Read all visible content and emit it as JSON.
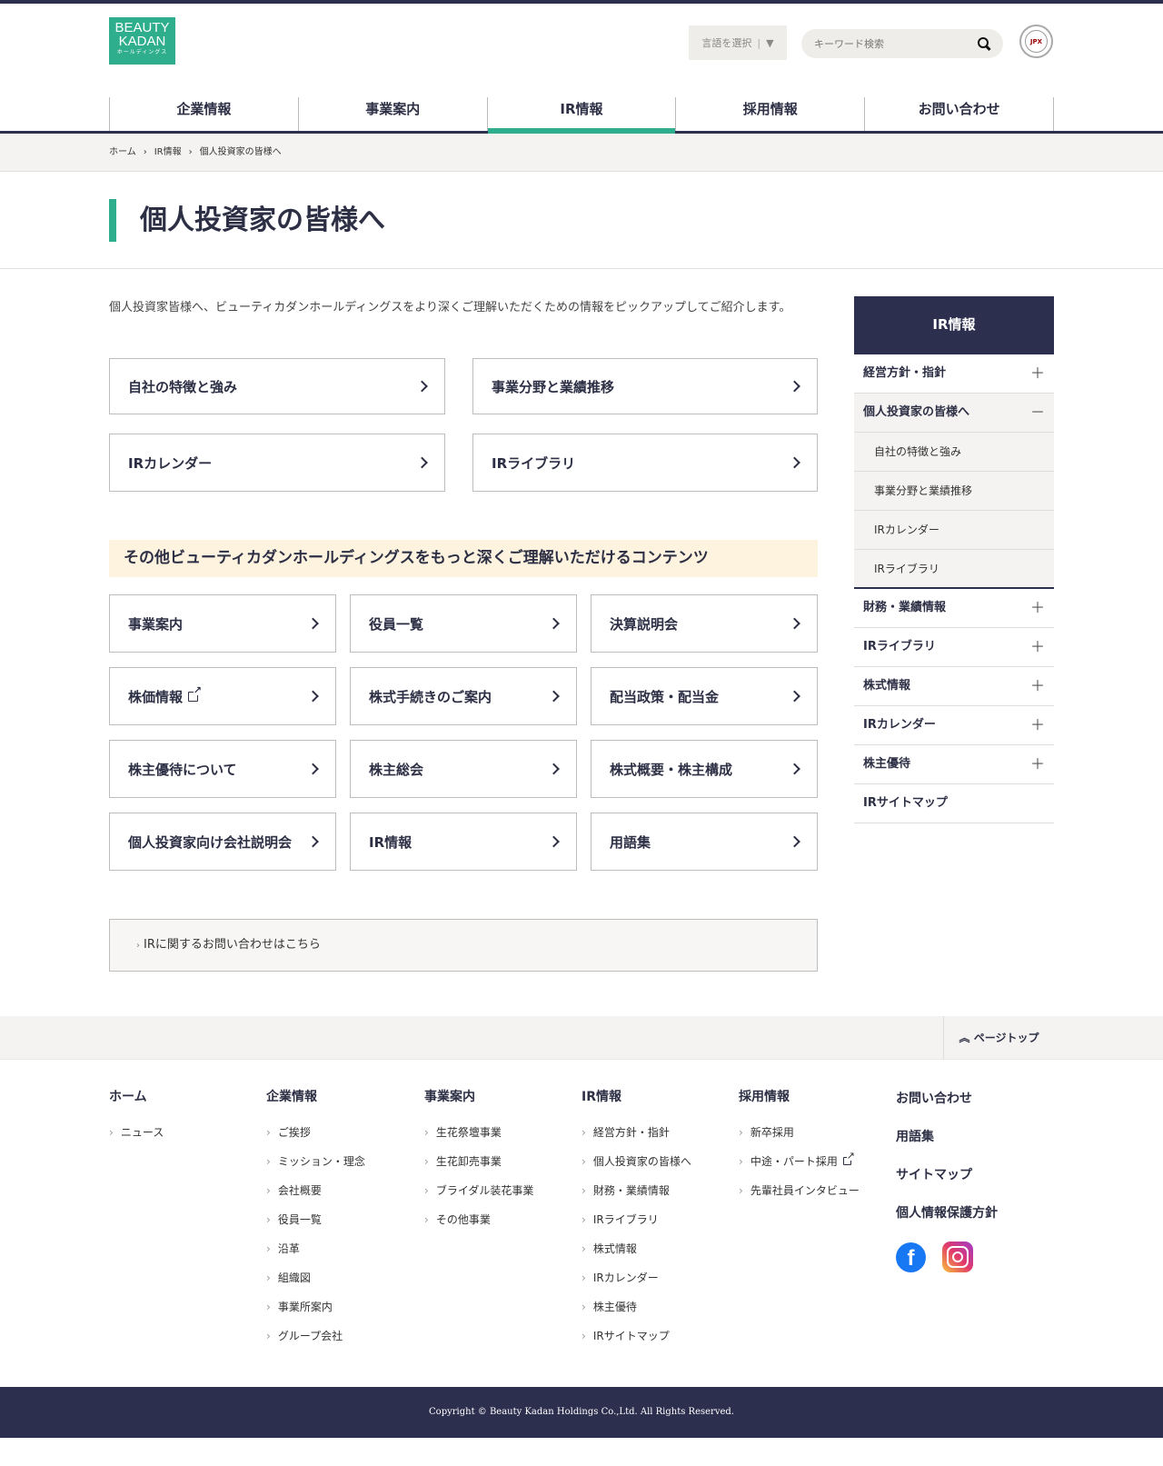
{
  "logo": {
    "line1": "BEAUTY",
    "line2": "KADAN",
    "line3": "ホールディングス"
  },
  "header": {
    "lang_label": "言語を選択",
    "lang_arrow": "▼",
    "search_placeholder": "キーワード検索",
    "seal_text": "JPX"
  },
  "gnav": [
    {
      "label": "企業情報"
    },
    {
      "label": "事業案内"
    },
    {
      "label": "IR情報"
    },
    {
      "label": "採用情報"
    },
    {
      "label": "お問い合わせ"
    }
  ],
  "breadcrumb": [
    "ホーム",
    "IR情報",
    "個人投資家の皆様へ"
  ],
  "page_title": "個人投資家の皆様へ",
  "lead": "個人投資家皆様へ、ビューティカダンホールディングスをより深くご理解いただくための情報をピックアップしてご紹介します。",
  "cards_top": [
    "自社の特徴と強み",
    "事業分野と業績推移",
    "IRカレンダー",
    "IRライブラリ"
  ],
  "band": "その他ビューティカダンホールディングスをもっと深くご理解いただけるコンテンツ",
  "cards_grid": [
    "事業案内",
    "役員一覧",
    "決算説明会",
    "株価情報",
    "株式手続きのご案内",
    "配当政策・配当金",
    "株主優待について",
    "株主総会",
    "株式概要・株主構成",
    "個人投資家向け会社説明会",
    "IR情報",
    "用語集"
  ],
  "contact": "IRに関するお問い合わせはこちら",
  "sidebar": {
    "head": "IR情報",
    "items": [
      {
        "label": "経営方針・指針",
        "sign": "＋"
      },
      {
        "label": "個人投資家の皆様へ",
        "sign": "－"
      },
      {
        "label": "財務・業績情報",
        "sign": "＋"
      },
      {
        "label": "IRライブラリ",
        "sign": "＋"
      },
      {
        "label": "株式情報",
        "sign": "＋"
      },
      {
        "label": "IRカレンダー",
        "sign": "＋"
      },
      {
        "label": "株主優待",
        "sign": "＋"
      },
      {
        "label": "IRサイトマップ",
        "sign": ""
      }
    ],
    "subs": [
      "自社の特徴と強み",
      "事業分野と業績推移",
      "IRカレンダー",
      "IRライブラリ"
    ]
  },
  "pagetop": "ページトップ",
  "footer": {
    "cols": [
      {
        "head": "ホーム",
        "items": [
          "ニュース"
        ]
      },
      {
        "head": "企業情報",
        "items": [
          "ご挨拶",
          "ミッション・理念",
          "会社概要",
          "役員一覧",
          "沿革",
          "組織図",
          "事業所案内",
          "グループ会社"
        ]
      },
      {
        "head": "事業案内",
        "items": [
          "生花祭壇事業",
          "生花卸売事業",
          "ブライダル装花事業",
          "その他事業"
        ]
      },
      {
        "head": "IR情報",
        "items": [
          "経営方針・指針",
          "個人投資家の皆様へ",
          "財務・業績情報",
          "IRライブラリ",
          "株式情報",
          "IRカレンダー",
          "株主優待",
          "IRサイトマップ"
        ]
      },
      {
        "head": "採用情報",
        "items": [
          "新卒採用",
          "中途・パート採用",
          "先輩社員インタビュー"
        ]
      }
    ],
    "links": [
      "お問い合わせ",
      "用語集",
      "サイトマップ",
      "個人情報保護方針"
    ],
    "fb_glyph": "f"
  },
  "copyright": "Copyright © Beauty Kadan Holdings Co.,Ltd. All Rights Reserved."
}
